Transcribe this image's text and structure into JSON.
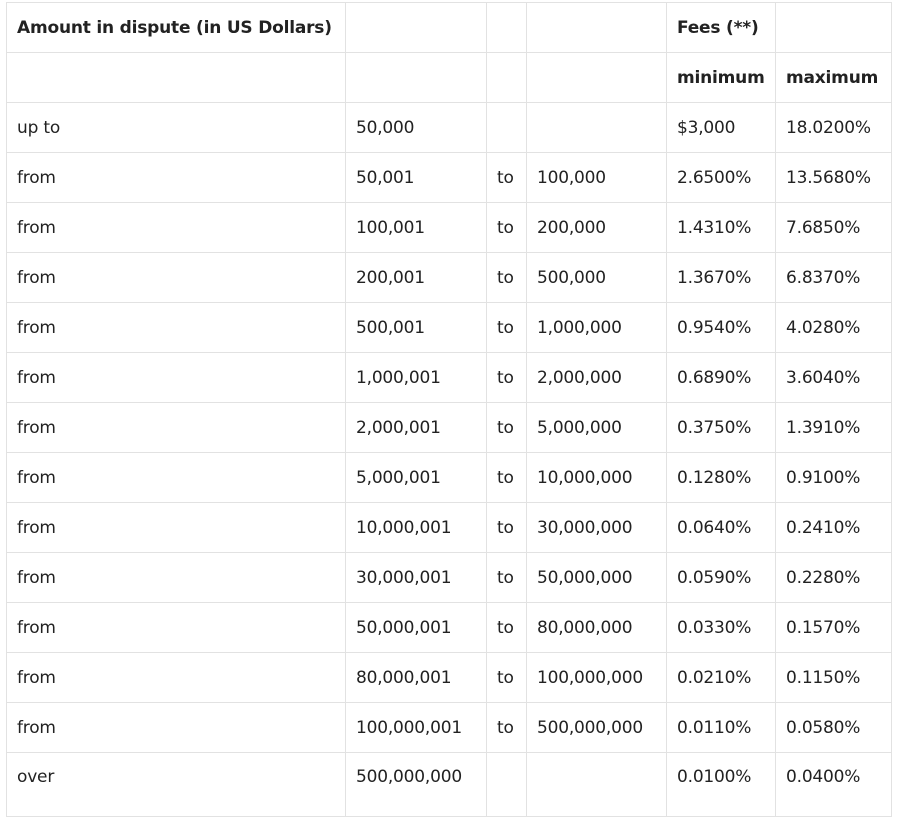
{
  "table": {
    "header": {
      "amount_label": "Amount in dispute (in US Dollars)",
      "fees_label": "Fees (**)",
      "minimum_label": "minimum",
      "maximum_label": "maximum"
    },
    "rows": [
      {
        "prefix": "up to",
        "from_amount": "50,000",
        "sep": "",
        "to_amount": "",
        "minimum": "$3,000",
        "maximum": "18.0200%"
      },
      {
        "prefix": "from",
        "from_amount": "50,001",
        "sep": "to",
        "to_amount": "100,000",
        "minimum": "2.6500%",
        "maximum": "13.5680%"
      },
      {
        "prefix": "from",
        "from_amount": "100,001",
        "sep": "to",
        "to_amount": "200,000",
        "minimum": "1.4310%",
        "maximum": "7.6850%"
      },
      {
        "prefix": "from",
        "from_amount": "200,001",
        "sep": "to",
        "to_amount": "500,000",
        "minimum": "1.3670%",
        "maximum": "6.8370%"
      },
      {
        "prefix": "from",
        "from_amount": "500,001",
        "sep": "to",
        "to_amount": "1,000,000",
        "minimum": "0.9540%",
        "maximum": "4.0280%"
      },
      {
        "prefix": "from",
        "from_amount": "1,000,001",
        "sep": "to",
        "to_amount": "2,000,000",
        "minimum": "0.6890%",
        "maximum": "3.6040%"
      },
      {
        "prefix": "from",
        "from_amount": "2,000,001",
        "sep": "to",
        "to_amount": "5,000,000",
        "minimum": "0.3750%",
        "maximum": "1.3910%"
      },
      {
        "prefix": "from",
        "from_amount": "5,000,001",
        "sep": "to",
        "to_amount": "10,000,000",
        "minimum": "0.1280%",
        "maximum": "0.9100%"
      },
      {
        "prefix": "from",
        "from_amount": "10,000,001",
        "sep": "to",
        "to_amount": "30,000,000",
        "minimum": "0.0640%",
        "maximum": "0.2410%"
      },
      {
        "prefix": "from",
        "from_amount": "30,000,001",
        "sep": "to",
        "to_amount": "50,000,000",
        "minimum": "0.0590%",
        "maximum": "0.2280%"
      },
      {
        "prefix": "from",
        "from_amount": "50,000,001",
        "sep": "to",
        "to_amount": "80,000,000",
        "minimum": "0.0330%",
        "maximum": "0.1570%"
      },
      {
        "prefix": "from",
        "from_amount": "80,000,001",
        "sep": "to",
        "to_amount": "100,000,000",
        "minimum": "0.0210%",
        "maximum": "0.1150%"
      },
      {
        "prefix": "from",
        "from_amount": "100,000,001",
        "sep": "to",
        "to_amount": "500,000,000",
        "minimum": "0.0110%",
        "maximum": "0.0580%"
      },
      {
        "prefix": "over",
        "from_amount": "500,000,000",
        "sep": "",
        "to_amount": "",
        "minimum": "0.0100%",
        "maximum": "0.0400%"
      }
    ]
  }
}
